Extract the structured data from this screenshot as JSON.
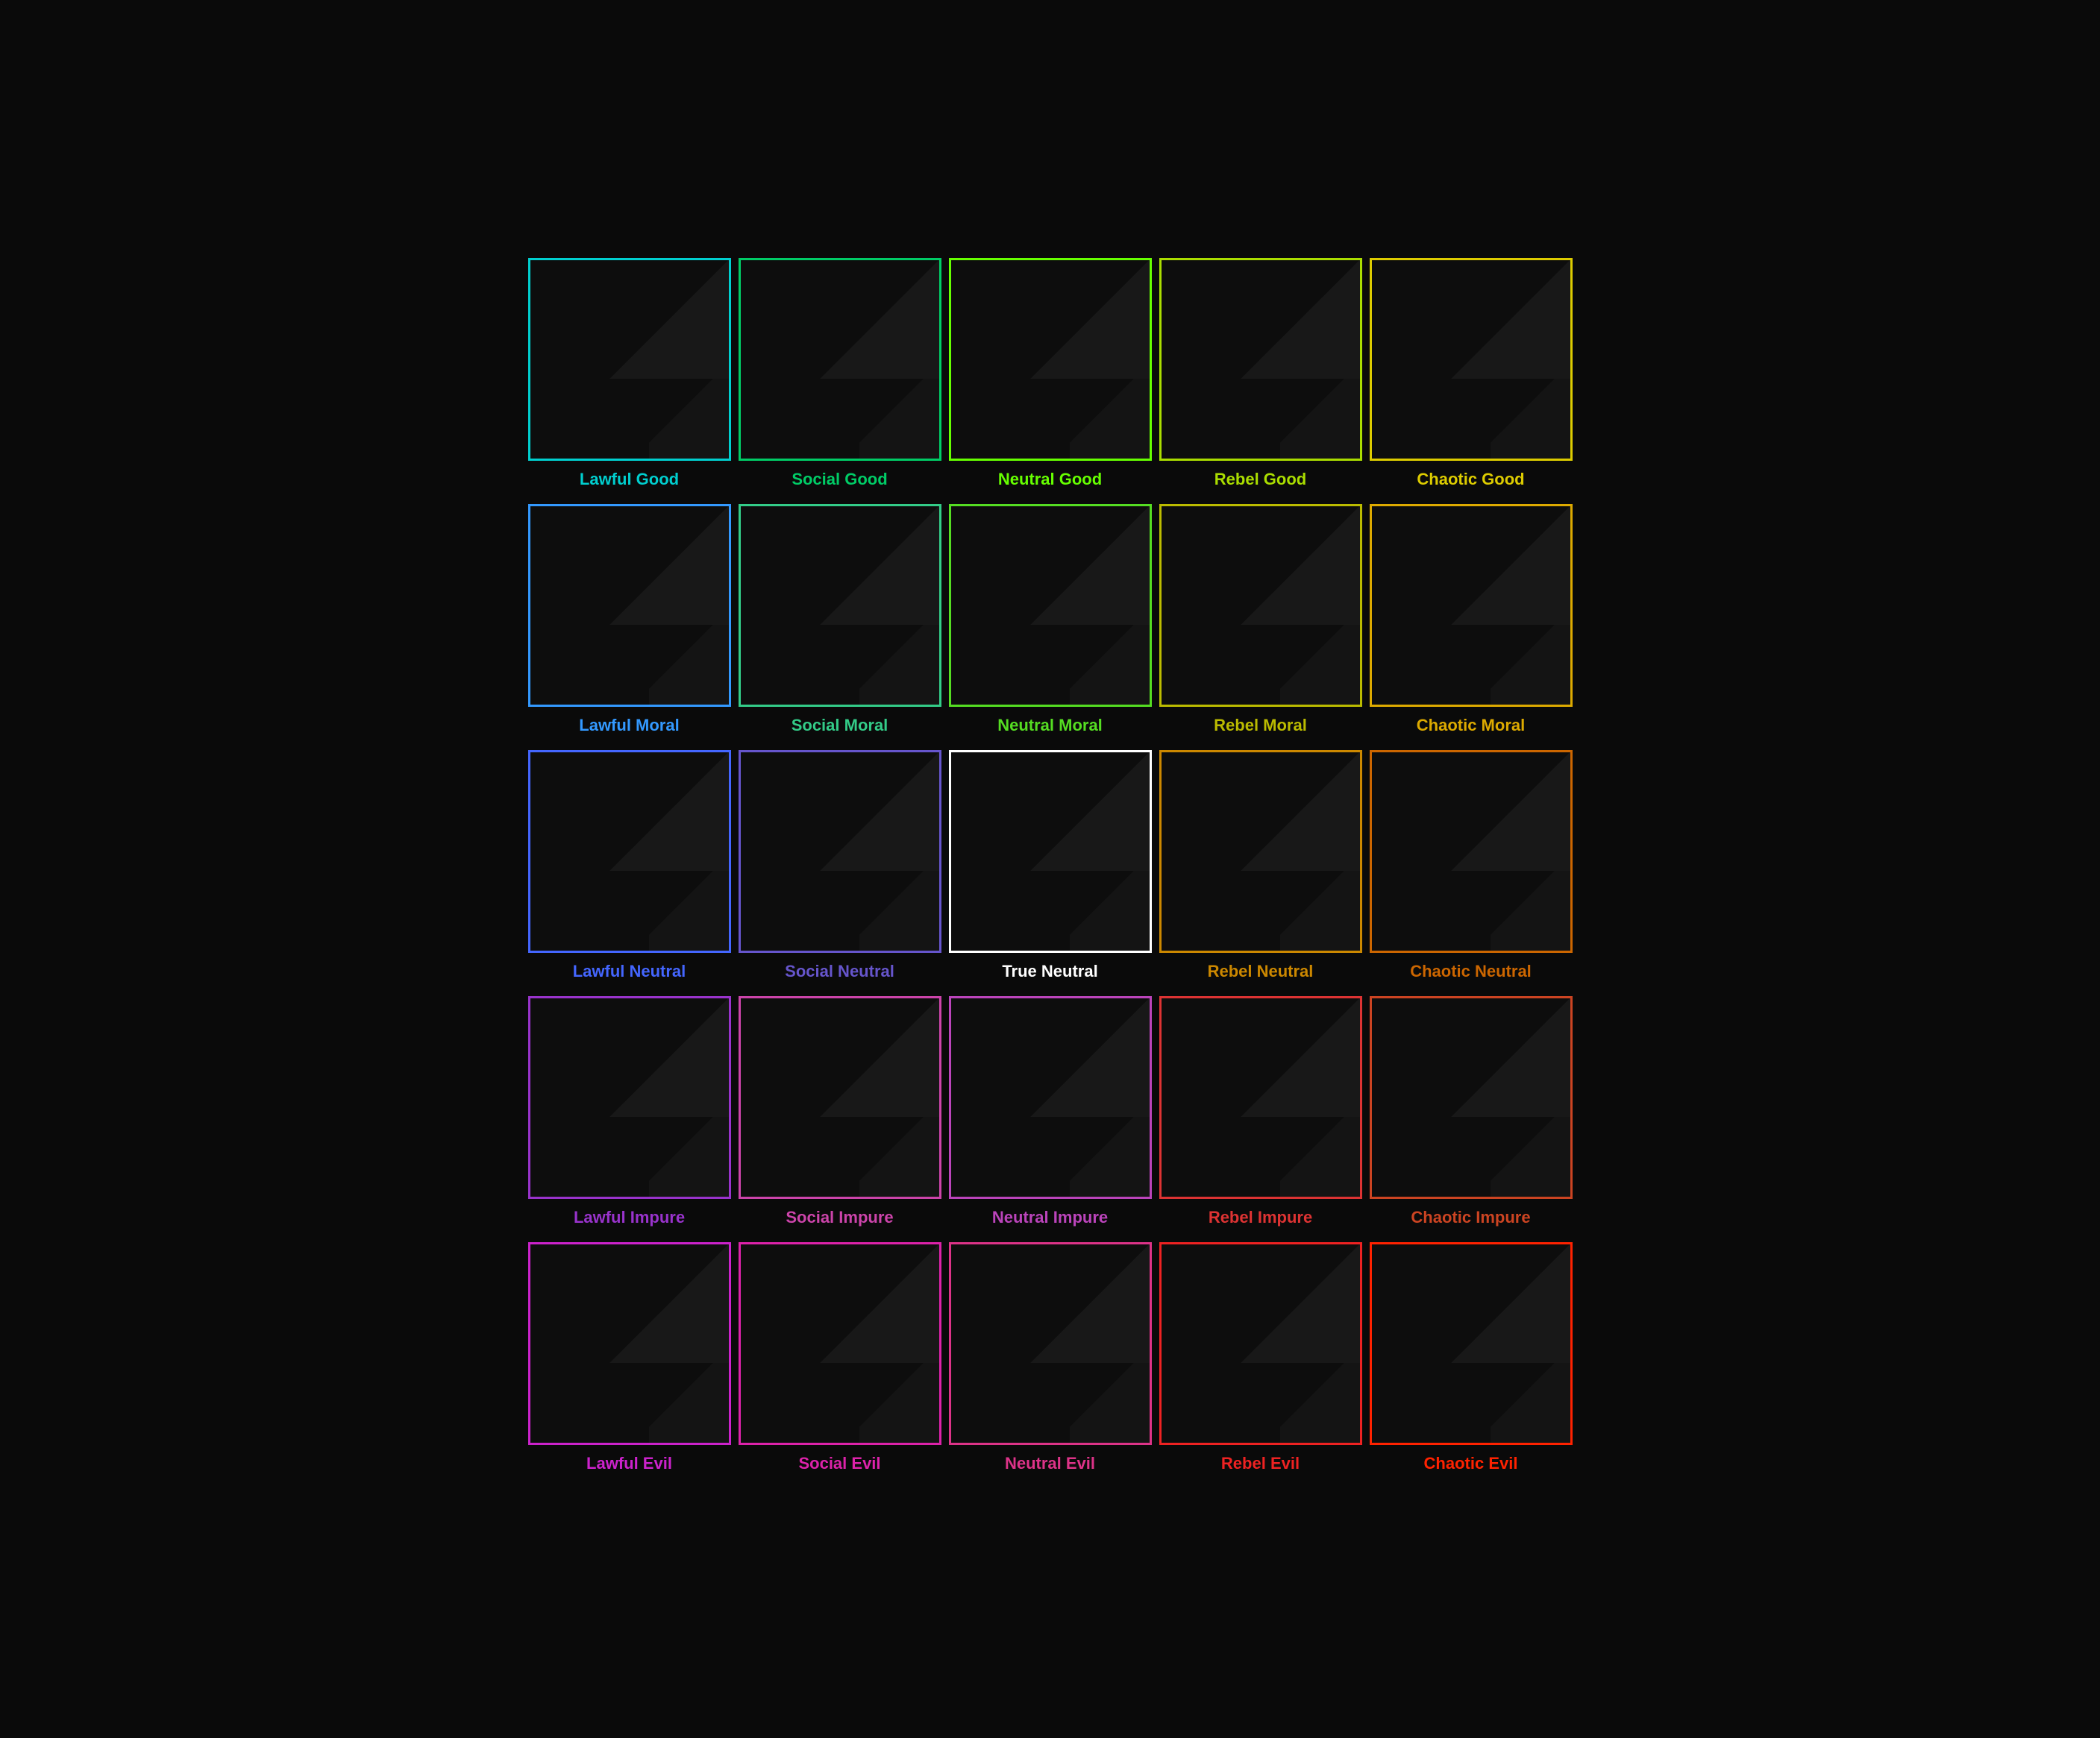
{
  "grid": {
    "cells": [
      {
        "id": "lawful-good",
        "label": "Lawful Good",
        "color": "#00cfcf"
      },
      {
        "id": "social-good",
        "label": "Social Good",
        "color": "#00cc66"
      },
      {
        "id": "neutral-good",
        "label": "Neutral Good",
        "color": "#66ff00"
      },
      {
        "id": "rebel-good",
        "label": "Rebel Good",
        "color": "#aadd00"
      },
      {
        "id": "chaotic-good",
        "label": "Chaotic Good",
        "color": "#ddcc00"
      },
      {
        "id": "lawful-moral",
        "label": "Lawful Moral",
        "color": "#3399ff"
      },
      {
        "id": "social-moral",
        "label": "Social Moral",
        "color": "#33cc88"
      },
      {
        "id": "neutral-moral",
        "label": "Neutral Moral",
        "color": "#55dd22"
      },
      {
        "id": "rebel-moral",
        "label": "Rebel Moral",
        "color": "#bbbb00"
      },
      {
        "id": "chaotic-moral",
        "label": "Chaotic Moral",
        "color": "#ddaa00"
      },
      {
        "id": "lawful-neutral",
        "label": "Lawful Neutral",
        "color": "#4466ff"
      },
      {
        "id": "social-neutral",
        "label": "Social Neutral",
        "color": "#6655cc"
      },
      {
        "id": "true-neutral",
        "label": "True Neutral",
        "color": "#ffffff"
      },
      {
        "id": "rebel-neutral",
        "label": "Rebel Neutral",
        "color": "#cc8800"
      },
      {
        "id": "chaotic-neutral",
        "label": "Chaotic Neutral",
        "color": "#cc6600"
      },
      {
        "id": "lawful-impure",
        "label": "Lawful Impure",
        "color": "#9933cc"
      },
      {
        "id": "social-impure",
        "label": "Social Impure",
        "color": "#cc44aa"
      },
      {
        "id": "neutral-impure",
        "label": "Neutral Impure",
        "color": "#bb44bb"
      },
      {
        "id": "rebel-impure",
        "label": "Rebel Impure",
        "color": "#dd3333"
      },
      {
        "id": "chaotic-impure",
        "label": "Chaotic Impure",
        "color": "#cc4422"
      },
      {
        "id": "lawful-evil",
        "label": "Lawful Evil",
        "color": "#cc22cc"
      },
      {
        "id": "social-evil",
        "label": "Social Evil",
        "color": "#dd22aa"
      },
      {
        "id": "neutral-evil",
        "label": "Neutral Evil",
        "color": "#dd3388"
      },
      {
        "id": "rebel-evil",
        "label": "Rebel Evil",
        "color": "#ee2222"
      },
      {
        "id": "chaotic-evil",
        "label": "Chaotic Evil",
        "color": "#ff2200"
      }
    ]
  }
}
